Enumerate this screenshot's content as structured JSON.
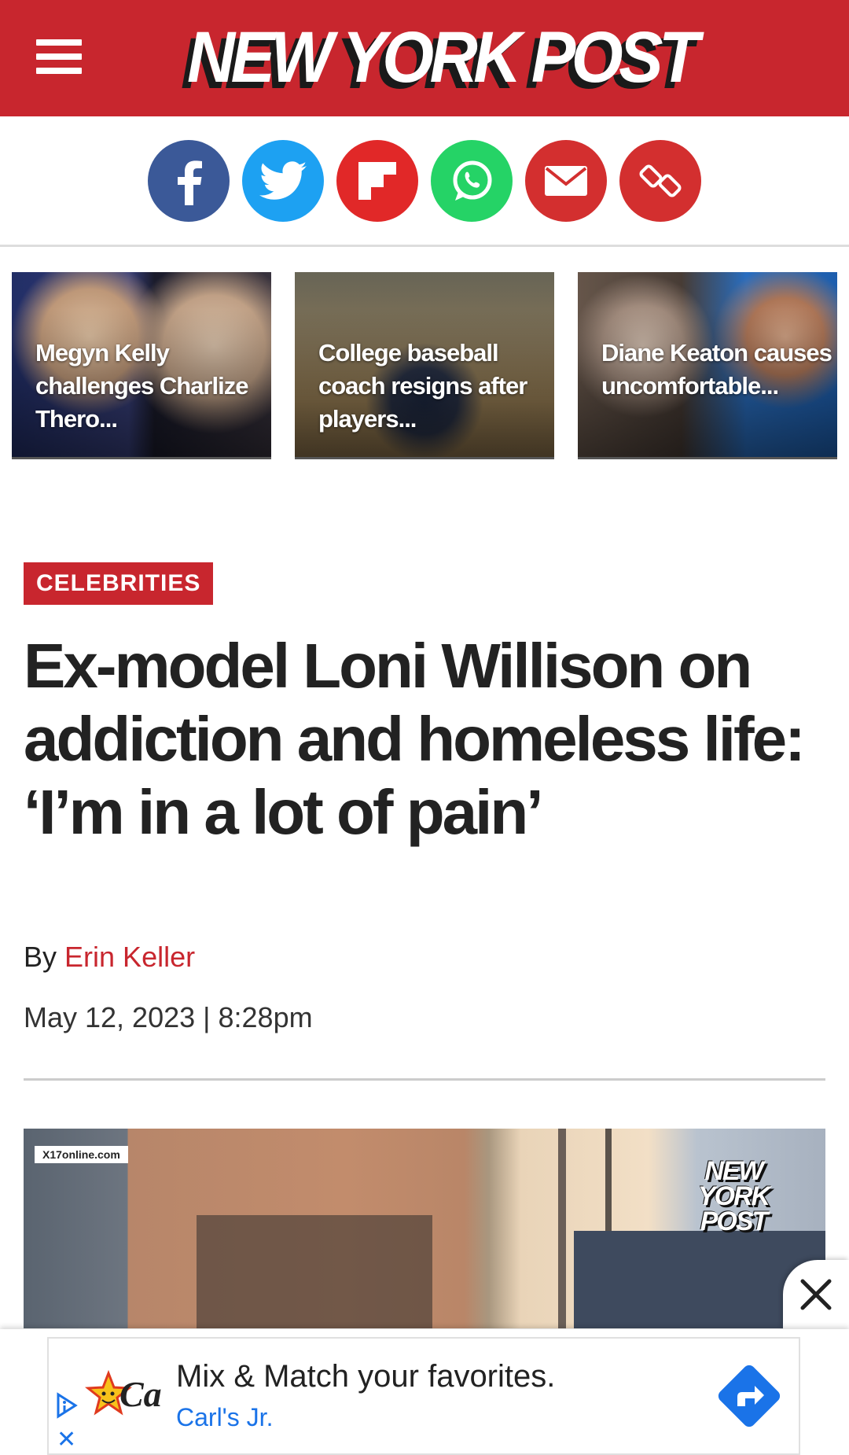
{
  "header": {
    "logo_text": "NEW YORK POST",
    "menu_icon": "hamburger-menu-icon"
  },
  "share": {
    "buttons": [
      {
        "name": "facebook",
        "color": "#3b5998"
      },
      {
        "name": "twitter",
        "color": "#1da1f2"
      },
      {
        "name": "flipboard",
        "color": "#e12828"
      },
      {
        "name": "whatsapp",
        "color": "#25d366"
      },
      {
        "name": "email",
        "color": "#d32f2f"
      },
      {
        "name": "copy-link",
        "color": "#d32f2f"
      }
    ]
  },
  "trending": [
    {
      "title": "Megyn Kelly challenges Charlize Thero..."
    },
    {
      "title": "College baseball coach resigns after players..."
    },
    {
      "title": "Diane Keaton causes uncomfortable..."
    }
  ],
  "article": {
    "category": "CELEBRITIES",
    "headline": "Ex-model Loni Willison on addiction and homeless life: ‘I’m in a lot of pain’",
    "by_label": "By",
    "author": "Erin Keller",
    "date": "May 12, 2023 | 8:28pm"
  },
  "video": {
    "watermark": "X17online.com",
    "overlay_logo": "NEW YORK POST"
  },
  "ad": {
    "headline": "Mix & Match your favorites.",
    "advertiser": "Carl's Jr.",
    "logo_text": "Ca",
    "close_icon": "close-icon",
    "adchoices_icon": "adchoices-icon",
    "go_icon": "directions-arrow-icon"
  },
  "colors": {
    "brand_red": "#c8262e",
    "link_blue": "#1a73e8"
  }
}
